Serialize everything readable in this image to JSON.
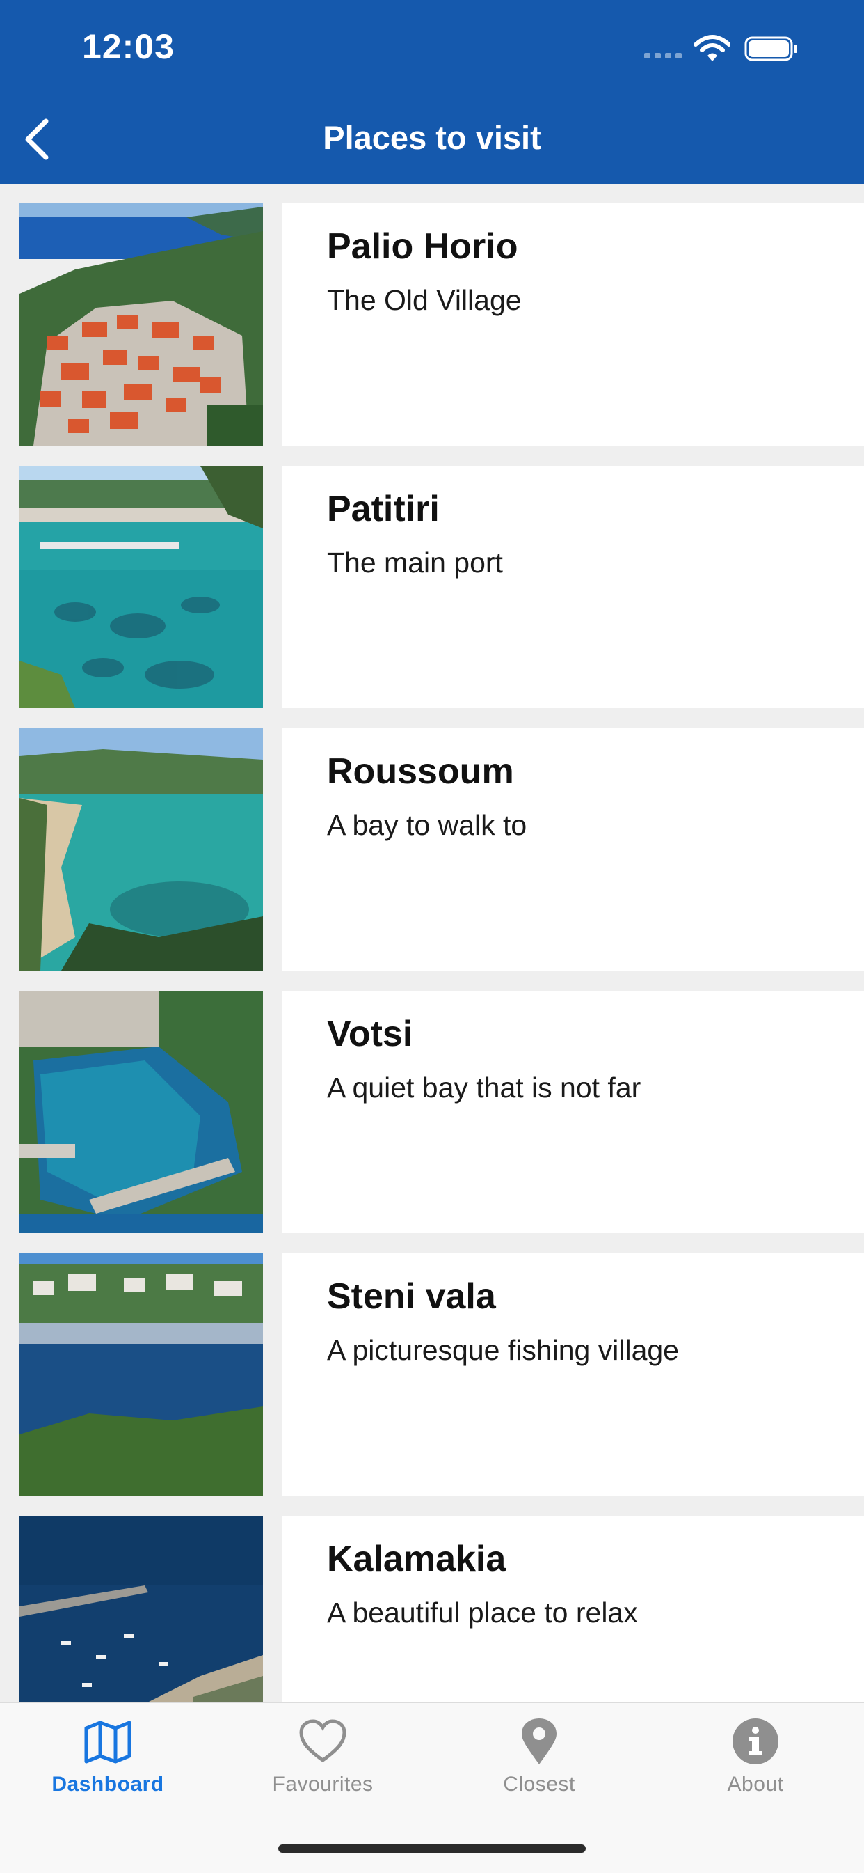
{
  "status_bar": {
    "time": "12:03"
  },
  "header": {
    "title": "Places to visit"
  },
  "places": [
    {
      "name": "Palio Horio",
      "description": "The Old Village"
    },
    {
      "name": "Patitiri",
      "description": "The main port"
    },
    {
      "name": "Roussoum",
      "description": "A bay to walk to"
    },
    {
      "name": "Votsi",
      "description": "A quiet bay that is not far"
    },
    {
      "name": "Steni vala",
      "description": "A picturesque fishing village"
    },
    {
      "name": "Kalamakia",
      "description": "A beautiful place to relax"
    }
  ],
  "tabs": [
    {
      "label": "Dashboard",
      "icon": "map-icon",
      "active": true
    },
    {
      "label": "Favourites",
      "icon": "heart-icon",
      "active": false
    },
    {
      "label": "Closest",
      "icon": "location-pin-icon",
      "active": false
    },
    {
      "label": "About",
      "icon": "info-icon",
      "active": false
    }
  ],
  "colors": {
    "header": "#1559ad",
    "active_tab": "#1876e0",
    "inactive_tab": "#8f8f8f"
  }
}
